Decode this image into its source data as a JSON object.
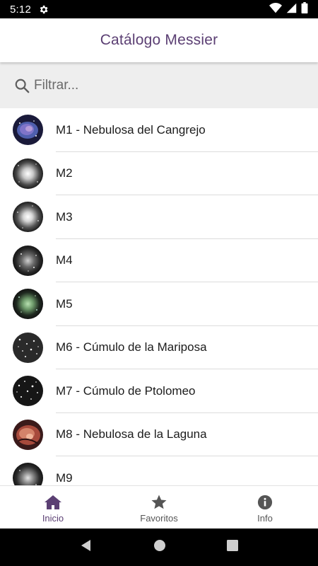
{
  "status_bar": {
    "time": "5:12"
  },
  "app_bar": {
    "title": "Catálogo Messier"
  },
  "search": {
    "placeholder": "Filtrar..."
  },
  "list": {
    "items": [
      {
        "label": "M1 - Nebulosa del Cangrejo",
        "thumb": "nebula-blue-icon"
      },
      {
        "label": "M2",
        "thumb": "globular-cluster-icon"
      },
      {
        "label": "M3",
        "thumb": "globular-cluster-icon"
      },
      {
        "label": "M4",
        "thumb": "globular-cluster-icon"
      },
      {
        "label": "M5",
        "thumb": "globular-cluster-green-icon"
      },
      {
        "label": "M6 - Cúmulo de la Mariposa",
        "thumb": "open-cluster-icon"
      },
      {
        "label": "M7 - Cúmulo de Ptolomeo",
        "thumb": "open-cluster-icon"
      },
      {
        "label": "M8 - Nebulosa de la Laguna",
        "thumb": "nebula-red-icon"
      },
      {
        "label": "M9",
        "thumb": "globular-cluster-icon"
      }
    ]
  },
  "bottom_nav": {
    "items": [
      {
        "label": "Inicio",
        "icon": "home-icon",
        "active": true
      },
      {
        "label": "Favoritos",
        "icon": "star-icon",
        "active": false
      },
      {
        "label": "Info",
        "icon": "info-icon",
        "active": false
      }
    ]
  },
  "colors": {
    "accent": "#5b3f73",
    "search_bg": "#eeeeee",
    "divider": "#dcdcdc",
    "inactive_nav": "#555555"
  }
}
